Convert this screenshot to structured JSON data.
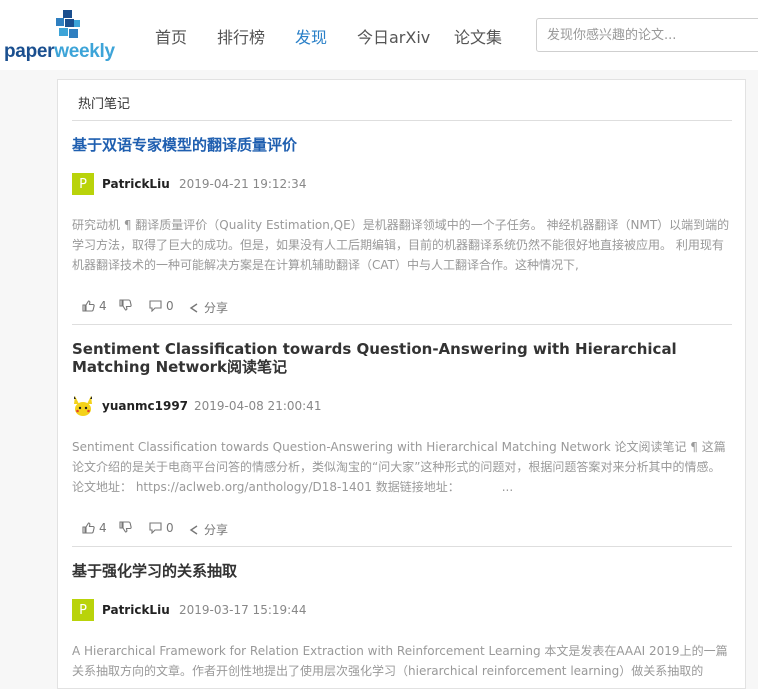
{
  "logo": {
    "part1": "paper",
    "part2": "weekly"
  },
  "nav": [
    {
      "label": "首页"
    },
    {
      "label": "排行榜"
    },
    {
      "label": "发现",
      "active": true
    },
    {
      "label": "今日arXiv"
    },
    {
      "label": "论文集"
    }
  ],
  "search": {
    "placeholder": "发现你感兴趣的论文..."
  },
  "panel": {
    "title": "热门笔记"
  },
  "notes": [
    {
      "title": "基于双语专家模型的翻译质量评价",
      "author": "PatrickLiu",
      "avatar_letter": "P",
      "date": "2019-04-21 19:12:34",
      "excerpt": "研究动机 ¶ 翻译质量评价（Quality Estimation,QE）是机器翻译领域中的一个子任务。 神经机器翻译（NMT）以端到端的学习方法，取得了巨大的成功。但是，如果没有人工后期编辑，目前的机器翻译系统仍然不能很好地直接被应用。 利用现有机器翻译技术的一种可能解决方案是在计算机辅助翻译（CAT）中与人工翻译合作。这种情况下,",
      "likes": "4",
      "comments": "0",
      "share": "分享"
    },
    {
      "title": "Sentiment Classification towards Question-Answering with Hierarchical Matching Network阅读笔记",
      "author": "yuanmc1997",
      "date": "2019-04-08 21:00:41",
      "excerpt": "Sentiment Classification towards Question-Answering with Hierarchical Matching Network 论文阅读笔记 ¶ 这篇论文介绍的是关于电商平台问答的情感分析，类似淘宝的“问大家”这种形式的问题对，根据问题答案对来分析其中的情感。 论文地址： https://aclweb.org/anthology/D18-1401 数据链接地址：　　　　...",
      "likes": "4",
      "comments": "0",
      "share": "分享"
    },
    {
      "title": "基于强化学习的关系抽取",
      "author": "PatrickLiu",
      "avatar_letter": "P",
      "date": "2019-03-17 15:19:44",
      "excerpt": "A Hierarchical Framework for Relation Extraction with Reinforcement Learning 本文是发表在AAAI 2019上的一篇关系抽取方向的文章。作者开创性地提出了使用层次强化学习（hierarchical reinforcement learning）做关系抽取的"
    }
  ],
  "colors": {
    "link_blue": "#1f5fb0",
    "nav_active": "#2a80c8",
    "avatar_green": "#b9d30a",
    "logo_dark": "#1a4f8f",
    "logo_light": "#3da4d8"
  },
  "icons": [
    "logo-mark-icon",
    "thumb-up-icon",
    "thumb-down-icon",
    "comment-icon",
    "share-icon",
    "pikachu-avatar-icon"
  ]
}
